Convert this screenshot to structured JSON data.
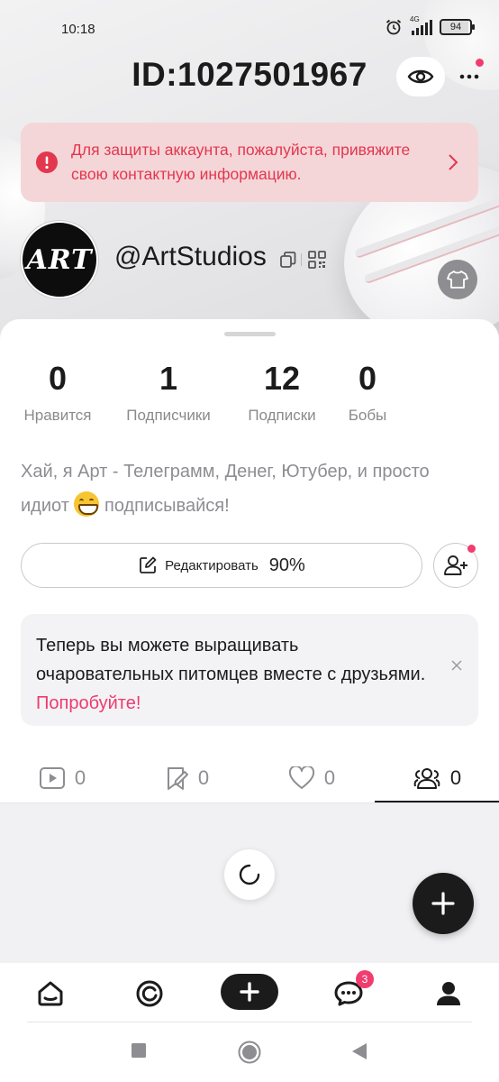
{
  "status_bar": {
    "time": "10:18",
    "network": "4G",
    "battery": "94"
  },
  "header": {
    "id_title": "ID:1027501967",
    "alert_text": "Для защиты аккаунта, пожалуйста, привяжите свою контактную информацию."
  },
  "profile": {
    "avatar_text": "ART",
    "username": "@ArtStudios"
  },
  "stats": [
    {
      "value": "0",
      "label": "Нравится"
    },
    {
      "value": "1",
      "label": "Подписчики"
    },
    {
      "value": "12",
      "label": "Подписки"
    },
    {
      "value": "0",
      "label": "Бобы"
    }
  ],
  "bio": {
    "line1": "Хай, я Арт - Телеграмм, Денег, Ютубер, и просто",
    "line2_pre": "идиот",
    "line2_post": "подписывайся!"
  },
  "edit_button": {
    "label": "Редактировать",
    "percent": "90%"
  },
  "pet_card": {
    "text": "Теперь вы можете выращивать очаровательных питомцев вместе с друзьями.",
    "link": "Попробуйте!"
  },
  "tabs": [
    {
      "icon": "video-icon",
      "count": "0"
    },
    {
      "icon": "bookmark-icon",
      "count": "0"
    },
    {
      "icon": "heart-icon",
      "count": "0"
    },
    {
      "icon": "friends-icon",
      "count": "0",
      "active": true
    }
  ],
  "bottom_nav": {
    "messages_badge": "3"
  },
  "colors": {
    "accent": "#f03c6e",
    "alert_bg": "#f5d6d8",
    "alert_text": "#e2374f",
    "dark": "#1b1b1b"
  }
}
